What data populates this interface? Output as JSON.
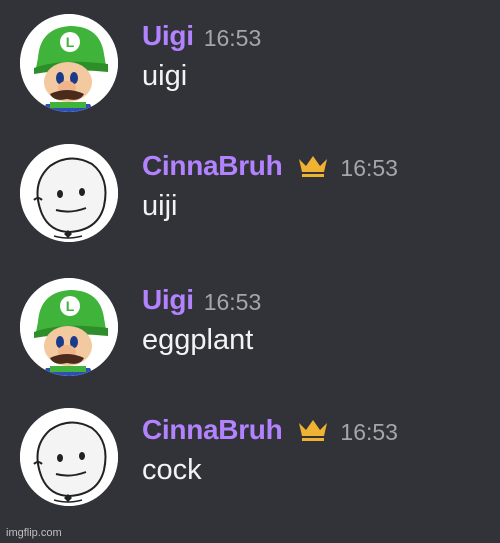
{
  "messages": [
    {
      "author": "Uigi",
      "timestamp": "16:53",
      "text": "uigi",
      "avatar_icon": "luigi-avatar-icon",
      "badge": null
    },
    {
      "author": "CinnaBruh",
      "timestamp": "16:53",
      "text": "uiji",
      "avatar_icon": "doodle-face-avatar-icon",
      "badge": "crown-icon"
    },
    {
      "author": "Uigi",
      "timestamp": "16:53",
      "text": "eggplant",
      "avatar_icon": "luigi-avatar-icon",
      "badge": null
    },
    {
      "author": "CinnaBruh",
      "timestamp": "16:53",
      "text": "cock",
      "avatar_icon": "doodle-face-avatar-icon",
      "badge": "crown-icon"
    }
  ],
  "watermark": "imgflip.com",
  "colors": {
    "background": "#313338",
    "username": "#b282ff",
    "timestamp": "#a3a6ad",
    "message_text": "#f2f3f5",
    "crown": "#f0b232"
  }
}
